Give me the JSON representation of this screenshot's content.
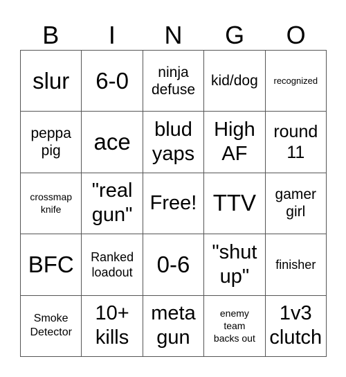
{
  "header": {
    "letters": [
      "B",
      "I",
      "N",
      "G",
      "O"
    ]
  },
  "cells": [
    {
      "text": "slur",
      "size": "xl"
    },
    {
      "text": "6-0",
      "size": "xl"
    },
    {
      "text": "ninja\ndefuse",
      "size": "sm"
    },
    {
      "text": "kid/dog",
      "size": "sm"
    },
    {
      "text": "recognized",
      "size": "micro"
    },
    {
      "text": "peppa\npig",
      "size": "sm"
    },
    {
      "text": "ace",
      "size": "xl"
    },
    {
      "text": "blud\nyaps",
      "size": "lg"
    },
    {
      "text": "High\nAF",
      "size": "lg"
    },
    {
      "text": "round\n11",
      "size": "md"
    },
    {
      "text": "crossmap\nknife",
      "size": "tiny"
    },
    {
      "text": "\"real\ngun\"",
      "size": "lg"
    },
    {
      "text": "Free!",
      "size": "lg"
    },
    {
      "text": "TTV",
      "size": "xl"
    },
    {
      "text": "gamer\ngirl",
      "size": "sm"
    },
    {
      "text": "BFC",
      "size": "xl"
    },
    {
      "text": "Ranked\nloadout",
      "size": "xs"
    },
    {
      "text": "0-6",
      "size": "xl"
    },
    {
      "text": "\"shut\nup\"",
      "size": "lg"
    },
    {
      "text": "finisher",
      "size": "xs"
    },
    {
      "text": "Smoke\nDetector",
      "size": "xxs"
    },
    {
      "text": "10+\nkills",
      "size": "lg"
    },
    {
      "text": "meta\ngun",
      "size": "lg"
    },
    {
      "text": "enemy\nteam\nbacks out",
      "size": "tiny"
    },
    {
      "text": "1v3\nclutch",
      "size": "lg"
    }
  ]
}
